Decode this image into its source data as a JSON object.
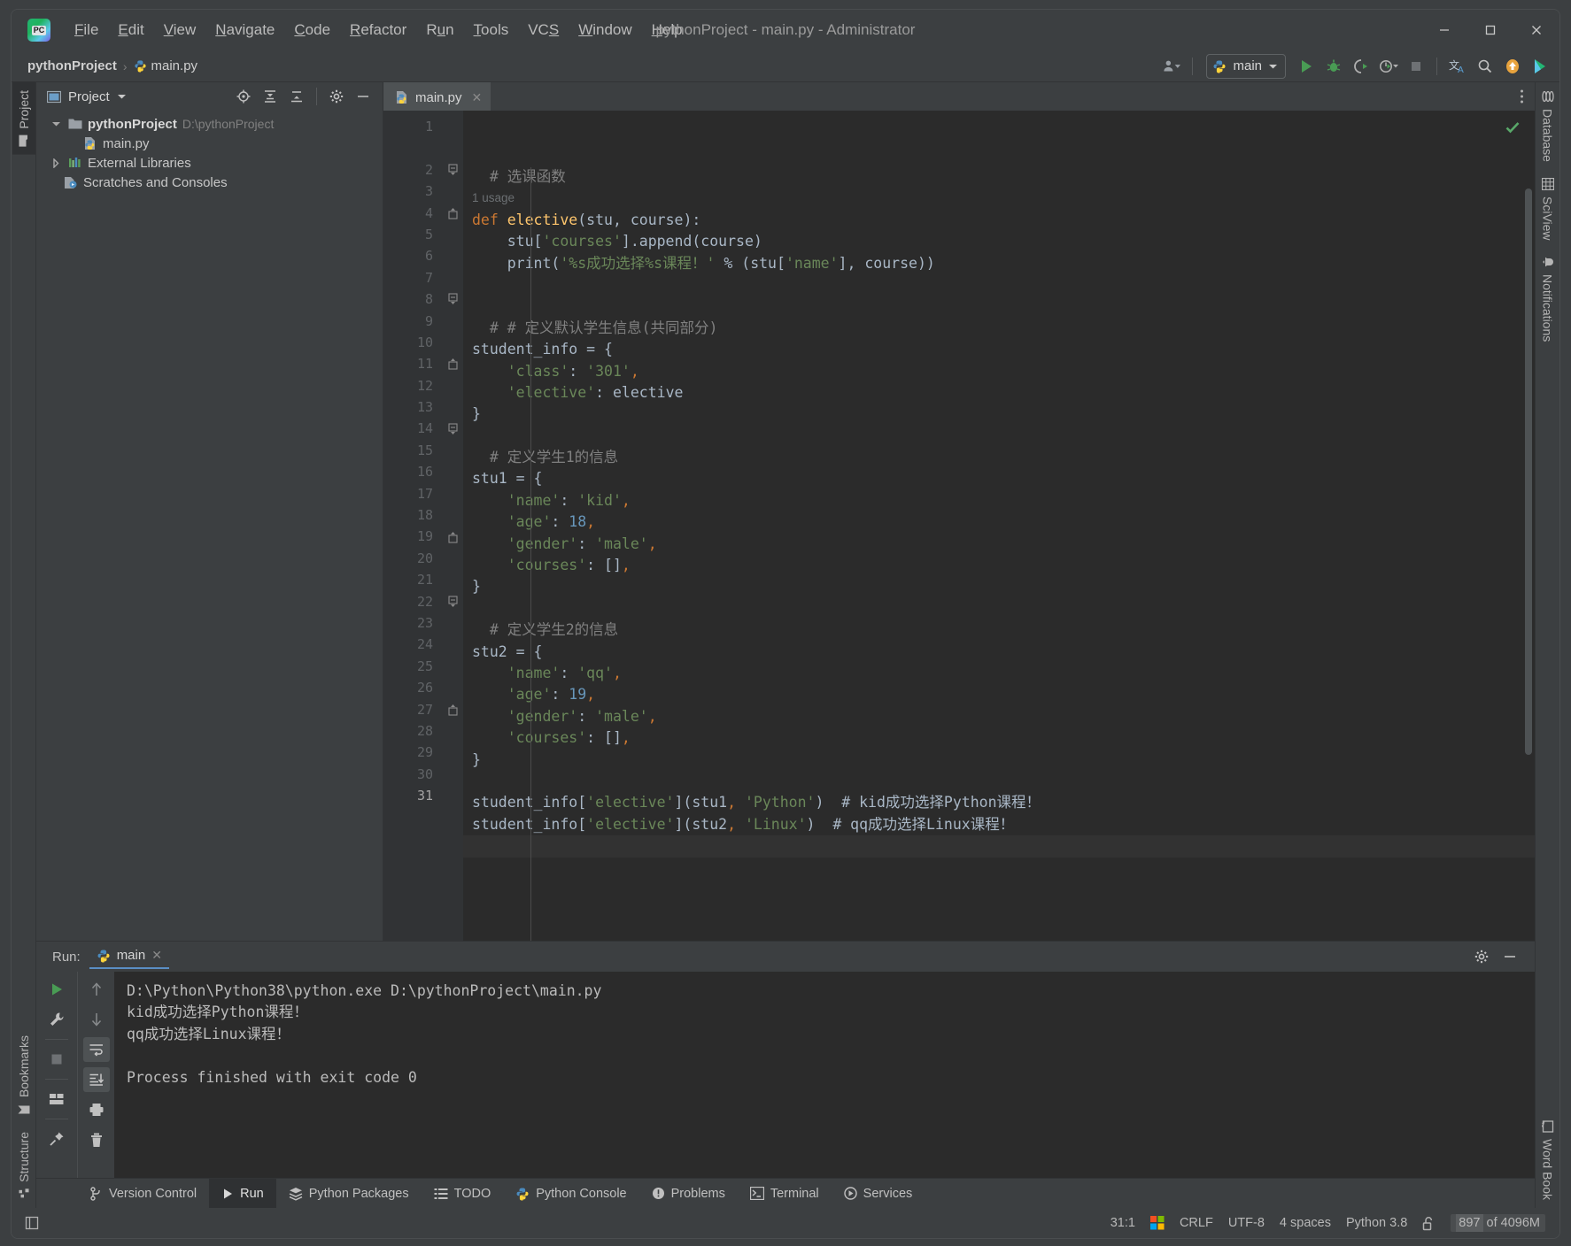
{
  "window": {
    "title": "pythonProject - main.py - Administrator",
    "minimize_label": "Minimize",
    "maximize_label": "Maximize",
    "close_label": "Close"
  },
  "menubar": [
    {
      "label": "File",
      "mnemonic": "F"
    },
    {
      "label": "Edit",
      "mnemonic": "E"
    },
    {
      "label": "View",
      "mnemonic": "V"
    },
    {
      "label": "Navigate",
      "mnemonic": "N"
    },
    {
      "label": "Code",
      "mnemonic": "C"
    },
    {
      "label": "Refactor",
      "mnemonic": "R"
    },
    {
      "label": "Run",
      "mnemonic": "u"
    },
    {
      "label": "Tools",
      "mnemonic": "T"
    },
    {
      "label": "VCS",
      "mnemonic": "S"
    },
    {
      "label": "Window",
      "mnemonic": "W"
    },
    {
      "label": "Help",
      "mnemonic": "H"
    }
  ],
  "navbar": {
    "breadcrumbs": [
      {
        "label": "pythonProject",
        "icon": "project-icon"
      },
      {
        "label": "main.py",
        "icon": "python-file-icon"
      }
    ],
    "separator": "›",
    "run_configuration": "main",
    "icons": [
      "account-icon",
      "run-icon",
      "debug-icon",
      "run-coverage-icon",
      "profile-icon",
      "stop-icon",
      "translate-icon",
      "search-icon",
      "update-icon",
      "ide-icon"
    ]
  },
  "left_strip": [
    {
      "label": "Project",
      "icon": "folder-icon",
      "active": true
    }
  ],
  "left_strip_bottom": [
    {
      "label": "Bookmarks",
      "icon": "bookmark-icon",
      "active": false
    },
    {
      "label": "Structure",
      "icon": "structure-icon",
      "active": false
    }
  ],
  "right_strip": [
    {
      "label": "Database",
      "icon": "database-icon"
    },
    {
      "label": "SciView",
      "icon": "grid-icon"
    },
    {
      "label": "Notifications",
      "icon": "bell-icon"
    }
  ],
  "right_strip_bottom": [
    {
      "label": "Word Book",
      "icon": "book-icon"
    }
  ],
  "project_panel": {
    "title": "Project",
    "toolbar_icons": [
      "locate-icon",
      "expand-all-icon",
      "collapse-all-icon",
      "settings-icon",
      "hide-icon"
    ],
    "tree": [
      {
        "label": "pythonProject",
        "path": "D:\\pythonProject",
        "icon": "folder-icon",
        "arrow": "down",
        "indent": 0,
        "bold": true
      },
      {
        "label": "main.py",
        "path": "",
        "icon": "python-file-icon",
        "arrow": "none",
        "indent": 1,
        "bold": false
      },
      {
        "label": "External Libraries",
        "path": "",
        "icon": "libraries-icon",
        "arrow": "right",
        "indent": 0,
        "bold": false
      },
      {
        "label": "Scratches and Consoles",
        "path": "",
        "icon": "scratches-icon",
        "arrow": "none",
        "indent": 0,
        "bold": false
      }
    ]
  },
  "editor": {
    "tabs": [
      {
        "label": "main.py",
        "icon": "python-file-icon",
        "active": true
      }
    ],
    "inspection_status": "ok-check-icon",
    "lines": [
      {
        "n": "1",
        "fold": "",
        "tokens": [
          {
            "t": "  # 选课函数",
            "c": "cm"
          }
        ]
      },
      {
        "n": "",
        "fold": "",
        "usage": "1 usage"
      },
      {
        "n": "2",
        "fold": "open",
        "tokens": [
          {
            "t": "def ",
            "c": "kw"
          },
          {
            "t": "elective",
            "c": "fn"
          },
          {
            "t": "(stu, course):",
            "c": "pn"
          }
        ]
      },
      {
        "n": "3",
        "fold": "",
        "tokens": [
          {
            "t": "    stu[",
            "c": "pn"
          },
          {
            "t": "'courses'",
            "c": "str"
          },
          {
            "t": "].append(course)",
            "c": "pn"
          }
        ]
      },
      {
        "n": "4",
        "fold": "close",
        "tokens": [
          {
            "t": "    print(",
            "c": "pn"
          },
          {
            "t": "'%s成功选择%s课程！'",
            "c": "str"
          },
          {
            "t": " % (stu[",
            "c": "pn"
          },
          {
            "t": "'name'",
            "c": "str"
          },
          {
            "t": "], course))",
            "c": "pn"
          }
        ]
      },
      {
        "n": "5",
        "fold": "",
        "tokens": []
      },
      {
        "n": "6",
        "fold": "",
        "tokens": []
      },
      {
        "n": "7",
        "fold": "",
        "tokens": [
          {
            "t": "  # # 定义默认学生信息(共同部分)",
            "c": "cm"
          }
        ]
      },
      {
        "n": "8",
        "fold": "open",
        "tokens": [
          {
            "t": "student_info = {",
            "c": "pn"
          }
        ]
      },
      {
        "n": "9",
        "fold": "",
        "tokens": [
          {
            "t": "    ",
            "c": "pn"
          },
          {
            "t": "'class'",
            "c": "str"
          },
          {
            "t": ": ",
            "c": "pn"
          },
          {
            "t": "'301'",
            "c": "str"
          },
          {
            "t": ",",
            "c": "kw"
          }
        ]
      },
      {
        "n": "10",
        "fold": "",
        "tokens": [
          {
            "t": "    ",
            "c": "pn"
          },
          {
            "t": "'elective'",
            "c": "str"
          },
          {
            "t": ": elective",
            "c": "pn"
          }
        ]
      },
      {
        "n": "11",
        "fold": "close",
        "tokens": [
          {
            "t": "}",
            "c": "pn"
          }
        ]
      },
      {
        "n": "12",
        "fold": "",
        "tokens": []
      },
      {
        "n": "13",
        "fold": "",
        "tokens": [
          {
            "t": "  # 定义学生1的信息",
            "c": "cm"
          }
        ]
      },
      {
        "n": "14",
        "fold": "open",
        "tokens": [
          {
            "t": "stu1 = {",
            "c": "pn"
          }
        ]
      },
      {
        "n": "15",
        "fold": "",
        "tokens": [
          {
            "t": "    ",
            "c": "pn"
          },
          {
            "t": "'name'",
            "c": "str"
          },
          {
            "t": ": ",
            "c": "pn"
          },
          {
            "t": "'kid'",
            "c": "str"
          },
          {
            "t": ",",
            "c": "kw"
          }
        ]
      },
      {
        "n": "16",
        "fold": "",
        "tokens": [
          {
            "t": "    ",
            "c": "pn"
          },
          {
            "t": "'age'",
            "c": "str"
          },
          {
            "t": ": ",
            "c": "pn"
          },
          {
            "t": "18",
            "c": "num"
          },
          {
            "t": ",",
            "c": "kw"
          }
        ]
      },
      {
        "n": "17",
        "fold": "",
        "tokens": [
          {
            "t": "    ",
            "c": "pn"
          },
          {
            "t": "'gender'",
            "c": "str"
          },
          {
            "t": ": ",
            "c": "pn"
          },
          {
            "t": "'male'",
            "c": "str"
          },
          {
            "t": ",",
            "c": "kw"
          }
        ]
      },
      {
        "n": "18",
        "fold": "",
        "tokens": [
          {
            "t": "    ",
            "c": "pn"
          },
          {
            "t": "'courses'",
            "c": "str"
          },
          {
            "t": ": []",
            "c": "pn"
          },
          {
            "t": ",",
            "c": "kw"
          }
        ]
      },
      {
        "n": "19",
        "fold": "close",
        "tokens": [
          {
            "t": "}",
            "c": "pn"
          }
        ]
      },
      {
        "n": "20",
        "fold": "",
        "tokens": []
      },
      {
        "n": "21",
        "fold": "",
        "tokens": [
          {
            "t": "  # 定义学生2的信息",
            "c": "cm"
          }
        ]
      },
      {
        "n": "22",
        "fold": "open",
        "tokens": [
          {
            "t": "stu2 = {",
            "c": "pn"
          }
        ]
      },
      {
        "n": "23",
        "fold": "",
        "tokens": [
          {
            "t": "    ",
            "c": "pn"
          },
          {
            "t": "'name'",
            "c": "str"
          },
          {
            "t": ": ",
            "c": "pn"
          },
          {
            "t": "'qq'",
            "c": "str"
          },
          {
            "t": ",",
            "c": "kw"
          }
        ]
      },
      {
        "n": "24",
        "fold": "",
        "tokens": [
          {
            "t": "    ",
            "c": "pn"
          },
          {
            "t": "'age'",
            "c": "str"
          },
          {
            "t": ": ",
            "c": "pn"
          },
          {
            "t": "19",
            "c": "num"
          },
          {
            "t": ",",
            "c": "kw"
          }
        ]
      },
      {
        "n": "25",
        "fold": "",
        "tokens": [
          {
            "t": "    ",
            "c": "pn"
          },
          {
            "t": "'gender'",
            "c": "str"
          },
          {
            "t": ": ",
            "c": "pn"
          },
          {
            "t": "'male'",
            "c": "str"
          },
          {
            "t": ",",
            "c": "kw"
          }
        ]
      },
      {
        "n": "26",
        "fold": "",
        "tokens": [
          {
            "t": "    ",
            "c": "pn"
          },
          {
            "t": "'courses'",
            "c": "str"
          },
          {
            "t": ": []",
            "c": "pn"
          },
          {
            "t": ",",
            "c": "kw"
          }
        ]
      },
      {
        "n": "27",
        "fold": "close",
        "tokens": [
          {
            "t": "}",
            "c": "pn"
          }
        ]
      },
      {
        "n": "28",
        "fold": "",
        "tokens": []
      },
      {
        "n": "29",
        "fold": "",
        "tokens": [
          {
            "t": "student_info[",
            "c": "pn"
          },
          {
            "t": "'elective'",
            "c": "str"
          },
          {
            "t": "](stu1",
            "c": "pn"
          },
          {
            "t": ",",
            "c": "kw"
          },
          {
            "t": " ",
            "c": "pn"
          },
          {
            "t": "'Python'",
            "c": "str"
          },
          {
            "t": ")  # kid成功选择Python课程！",
            "c": "pn"
          }
        ]
      },
      {
        "n": "30",
        "fold": "",
        "tokens": [
          {
            "t": "student_info[",
            "c": "pn"
          },
          {
            "t": "'elective'",
            "c": "str"
          },
          {
            "t": "](stu2",
            "c": "pn"
          },
          {
            "t": ",",
            "c": "kw"
          },
          {
            "t": " ",
            "c": "pn"
          },
          {
            "t": "'Linux'",
            "c": "str"
          },
          {
            "t": ")  # qq成功选择Linux课程！",
            "c": "pn"
          }
        ]
      },
      {
        "n": "31",
        "fold": "",
        "tokens": [],
        "current": true
      }
    ]
  },
  "run_panel": {
    "label": "Run:",
    "tab": "main",
    "tab_icon": "python-file-icon",
    "tool_icons": [
      "rerun-icon",
      "wrench-icon",
      "stop-icon",
      "layout-icon",
      "pin-icon"
    ],
    "tool_icons2": [
      "up-arrow-icon",
      "down-arrow-icon",
      "soft-wrap-icon",
      "scroll-to-end-icon",
      "print-icon",
      "trash-icon"
    ],
    "header_icons": [
      "settings-icon",
      "hide-icon"
    ],
    "output": [
      "D:\\Python\\Python38\\python.exe D:\\pythonProject\\main.py",
      "kid成功选择Python课程！",
      "qq成功选择Linux课程！",
      "",
      "Process finished with exit code 0"
    ]
  },
  "tool_window_bar": [
    {
      "label": "Version Control",
      "icon": "branch-icon",
      "active": false
    },
    {
      "label": "Run",
      "icon": "run-icon",
      "active": true
    },
    {
      "label": "Python Packages",
      "icon": "packages-icon",
      "active": false
    },
    {
      "label": "TODO",
      "icon": "todo-icon",
      "active": false
    },
    {
      "label": "Python Console",
      "icon": "python-icon",
      "active": false
    },
    {
      "label": "Problems",
      "icon": "problems-icon",
      "active": false
    },
    {
      "label": "Terminal",
      "icon": "terminal-icon",
      "active": false
    },
    {
      "label": "Services",
      "icon": "services-icon",
      "active": false
    }
  ],
  "status_bar": {
    "left_icon": "layout-toggle-icon",
    "caret_position": "31:1",
    "os_icon": "windows-icon",
    "line_separator": "CRLF",
    "encoding": "UTF-8",
    "indent": "4 spaces",
    "interpreter": "Python 3.8",
    "lock_icon": "unlocked-icon",
    "memory_used": "897",
    "memory_total": "of 4096M"
  },
  "colors": {
    "background": "#3c3f41",
    "editor_background": "#2b2b2b",
    "gutter": "#313335",
    "keyword": "#cc7832",
    "string": "#6a8759",
    "number": "#6897bb",
    "function": "#ffc66d",
    "comment": "#808080",
    "default_text": "#a9b7c6",
    "accent": "#5a8ec4",
    "run_green": "#499c54"
  }
}
